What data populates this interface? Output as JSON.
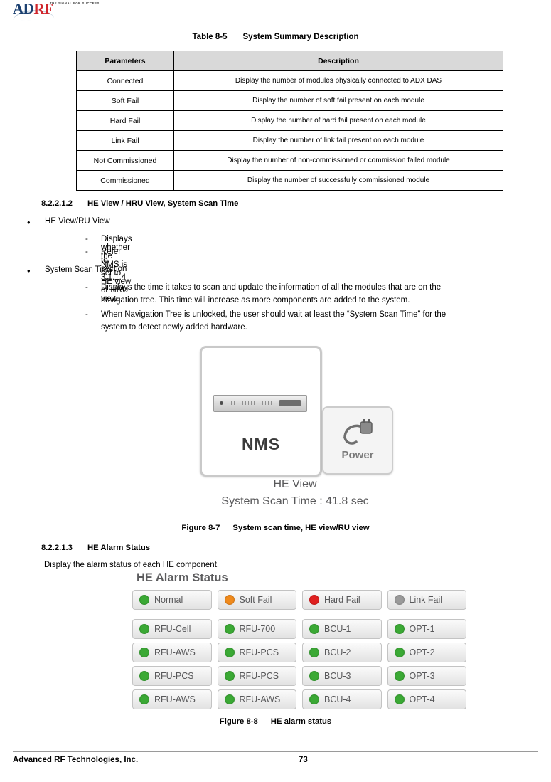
{
  "header": {
    "logo_main": "AD",
    "logo_accent": "RF",
    "tagline": "THE SIGNAL FOR SUCCESS"
  },
  "table_caption": {
    "label": "Table 8-5",
    "title": "System Summary Description"
  },
  "table": {
    "headers": [
      "Parameters",
      "Description"
    ],
    "rows": [
      [
        "Connected",
        "Display the number of modules physically connected to ADX DAS"
      ],
      [
        "Soft Fail",
        "Display the number of soft fail present on each module"
      ],
      [
        "Hard Fail",
        "Display the number of hard fail present on each module"
      ],
      [
        "Link Fail",
        "Display the number of link fail present on each module"
      ],
      [
        "Not Commissioned",
        "Display the number of non-commissioned or commission failed module"
      ],
      [
        "Commissioned",
        "Display the number of successfully commissioned module"
      ]
    ]
  },
  "section_1": {
    "number": "8.2.2.1.2",
    "title": "HE View / HRU View, System Scan Time",
    "bullet_1": "HE View/RU View",
    "bullet_1_sub": [
      "Displays whether the NMS is set to HE view or HRU view.",
      "Refer to section 3.1.1.4"
    ],
    "bullet_2": "System Scan Time",
    "bullet_2_sub_1_line1": "Displays the time it takes to scan and update the information of all the modules that are on the",
    "bullet_2_sub_1_line2": "navigation tree.  This time will increase as more components are added to the system.",
    "bullet_2_sub_2_line1": "When Navigation Tree is unlocked, the user should wait at least the “System Scan Time” for the",
    "bullet_2_sub_2_line2": "system to detect newly added hardware."
  },
  "nms_figure": {
    "device_label": "NMS",
    "power_label": "Power",
    "he_view": "HE View",
    "scan_time": "System Scan Time : 41.8 sec"
  },
  "figure_7_caption": {
    "label": "Figure 8-7",
    "title": "System scan time, HE view/RU view"
  },
  "section_2": {
    "number": "8.2.2.1.3",
    "title": "HE Alarm Status",
    "body": "Display the alarm status of each HE component."
  },
  "alarm_figure": {
    "title": "HE Alarm Status",
    "legend": [
      {
        "label": "Normal",
        "color": "#3ba935"
      },
      {
        "label": "Soft Fail",
        "color": "#f08a1c"
      },
      {
        "label": "Hard Fail",
        "color": "#e02020"
      },
      {
        "label": "Link Fail",
        "color": "#9a9a9a"
      }
    ],
    "rows": [
      [
        {
          "label": "RFU-Cell",
          "color": "#3ba935"
        },
        {
          "label": "RFU-700",
          "color": "#3ba935"
        },
        {
          "label": "BCU-1",
          "color": "#3ba935"
        },
        {
          "label": "OPT-1",
          "color": "#3ba935"
        }
      ],
      [
        {
          "label": "RFU-AWS",
          "color": "#3ba935"
        },
        {
          "label": "RFU-PCS",
          "color": "#3ba935"
        },
        {
          "label": "BCU-2",
          "color": "#3ba935"
        },
        {
          "label": "OPT-2",
          "color": "#3ba935"
        }
      ],
      [
        {
          "label": "RFU-PCS",
          "color": "#3ba935"
        },
        {
          "label": "RFU-PCS",
          "color": "#3ba935"
        },
        {
          "label": "BCU-3",
          "color": "#3ba935"
        },
        {
          "label": "OPT-3",
          "color": "#3ba935"
        }
      ],
      [
        {
          "label": "RFU-AWS",
          "color": "#3ba935"
        },
        {
          "label": "RFU-AWS",
          "color": "#3ba935"
        },
        {
          "label": "BCU-4",
          "color": "#3ba935"
        },
        {
          "label": "OPT-4",
          "color": "#3ba935"
        }
      ]
    ]
  },
  "figure_8_caption": {
    "label": "Figure 8-8",
    "title": "HE alarm status"
  },
  "footer": {
    "company": "Advanced RF Technologies, Inc.",
    "page": "73"
  }
}
